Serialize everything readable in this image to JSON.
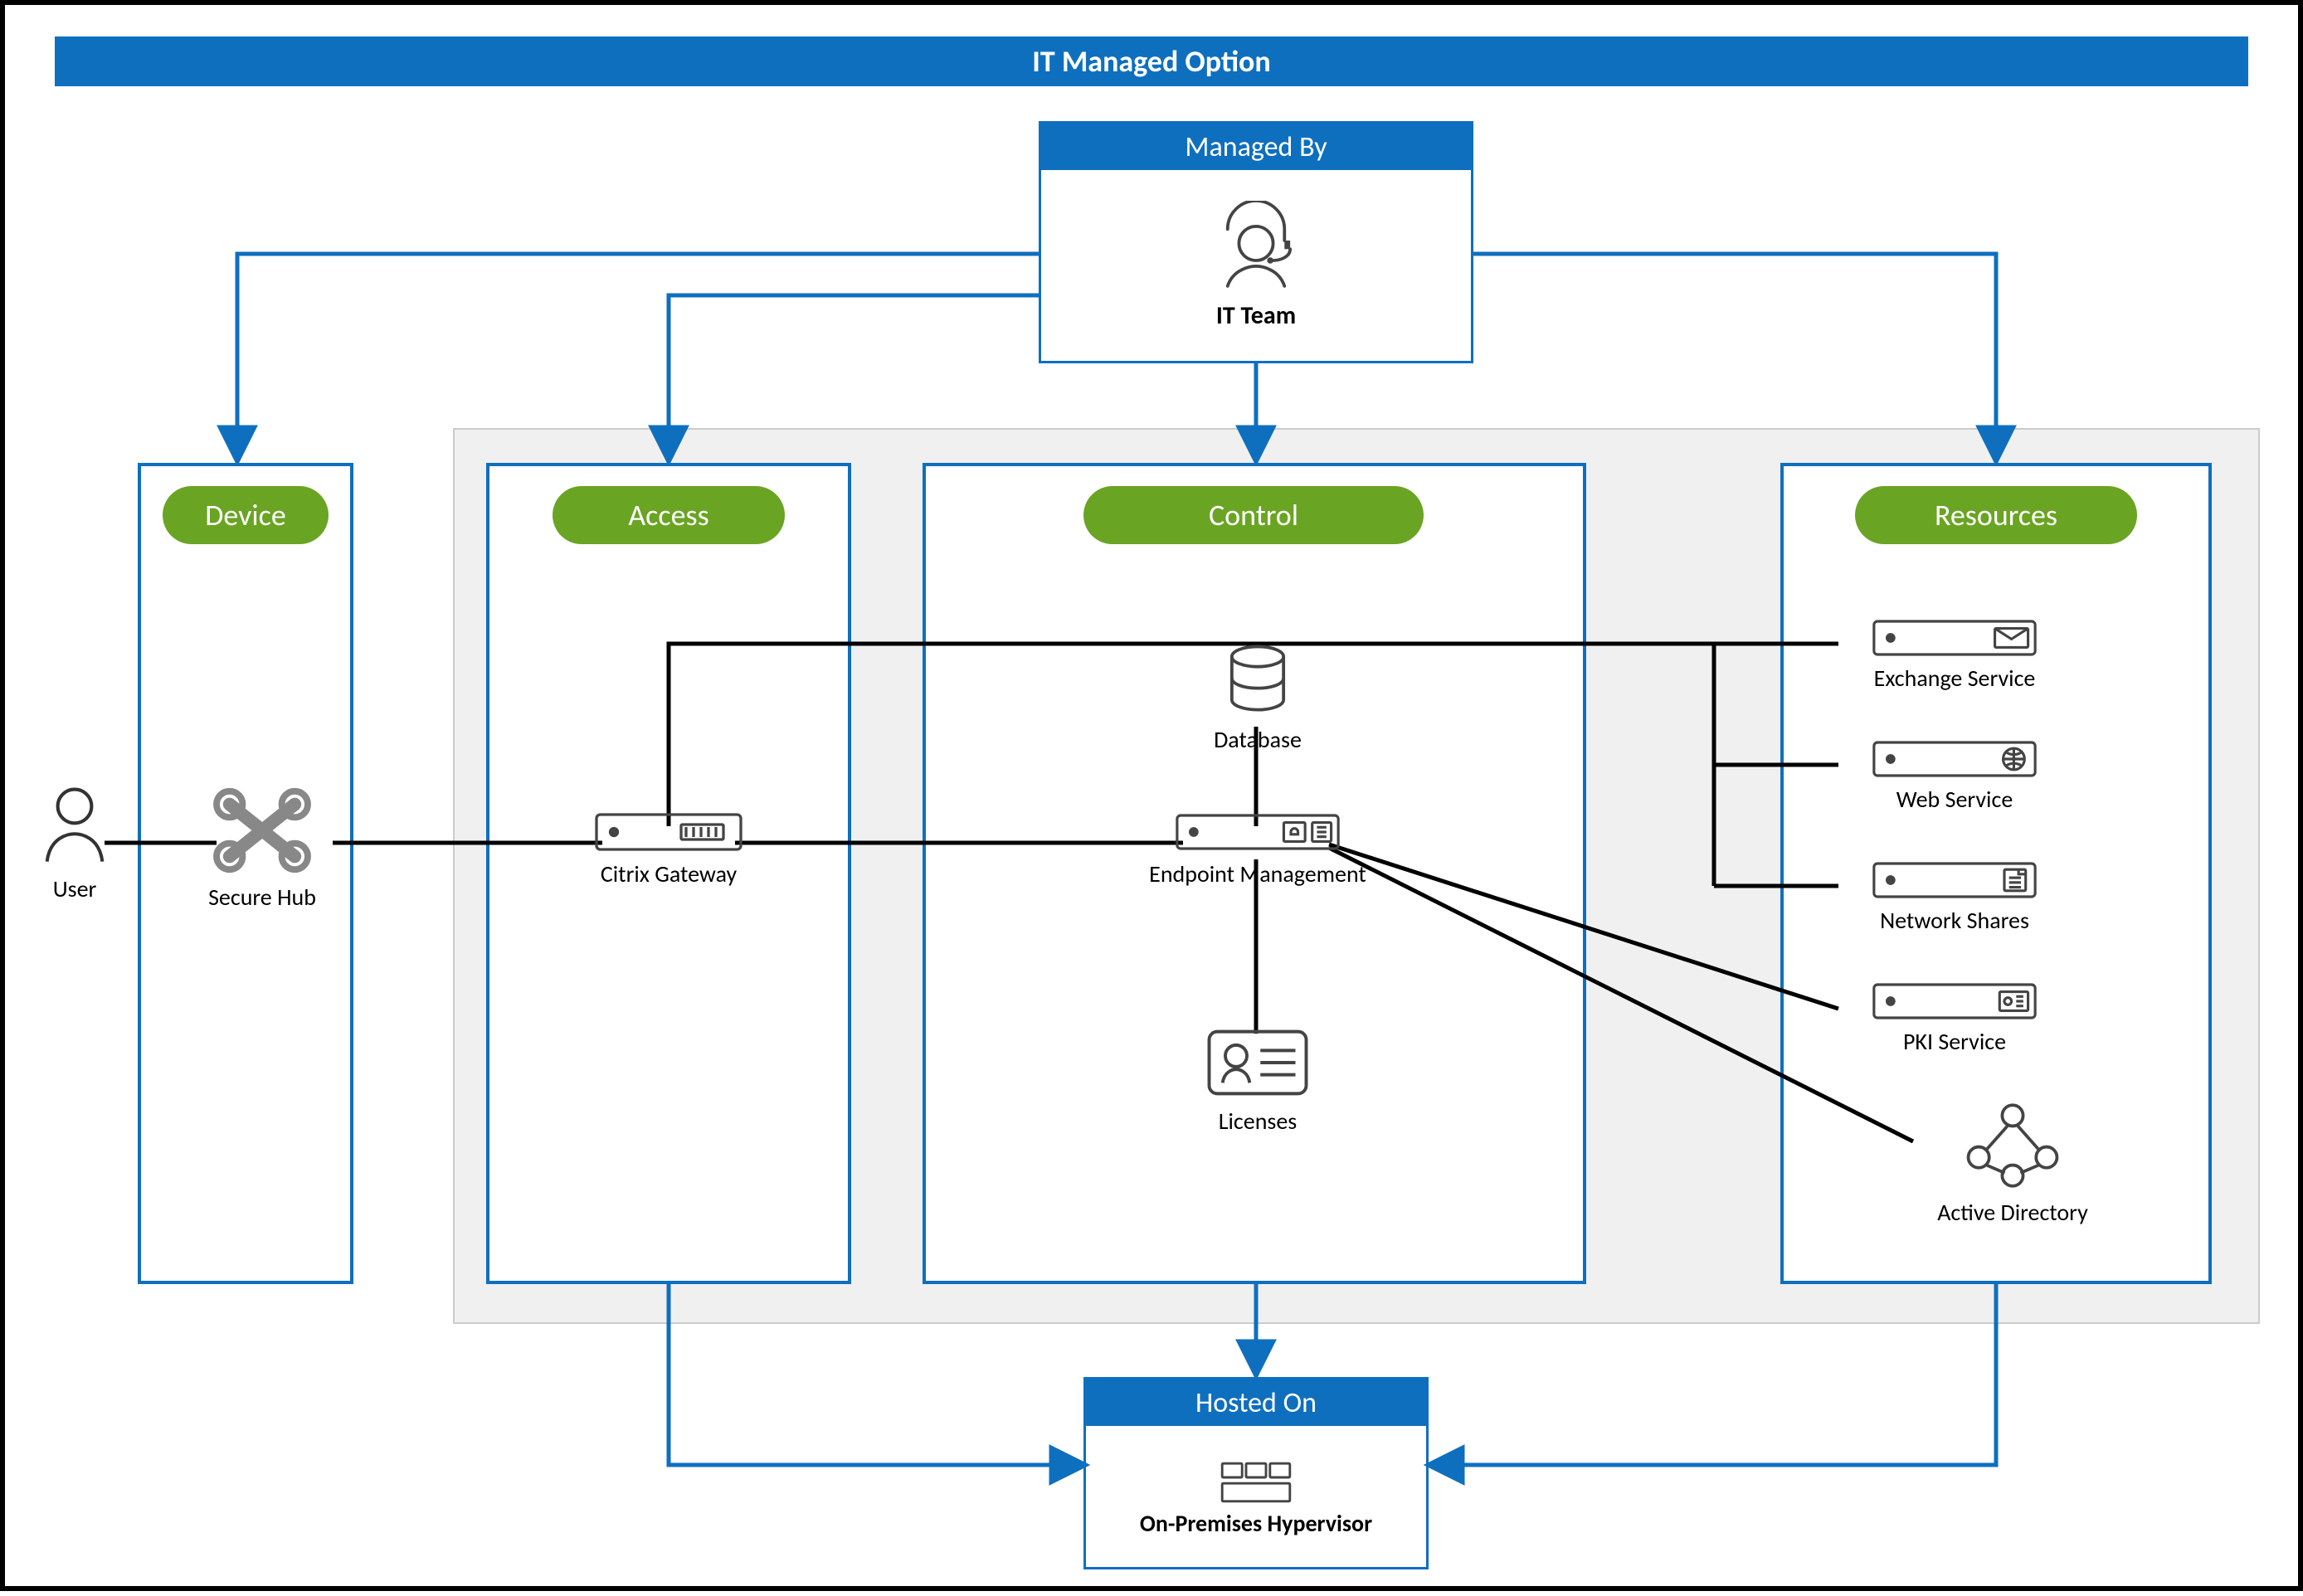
{
  "title": "IT Managed Option",
  "managedBy": {
    "header": "Managed By",
    "label": "IT Team"
  },
  "hostedOn": {
    "header": "Hosted On",
    "label": "On-Premises Hypervisor"
  },
  "zones": {
    "device": "Device",
    "access": "Access",
    "control": "Control",
    "resources": "Resources"
  },
  "nodes": {
    "user": "User",
    "secureHub": "Secure Hub",
    "gateway": "Citrix Gateway",
    "database": "Database",
    "endpoint": "Endpoint Management",
    "licenses": "Licenses",
    "exchange": "Exchange Service",
    "web": "Web Service",
    "shares": "Network Shares",
    "pki": "PKI Service",
    "ad": "Active Directory"
  },
  "colors": {
    "blue": "#0f6fbf",
    "green": "#6aa423",
    "black": "#000000",
    "grey": "#f0f0f0",
    "stroke": "#333333"
  },
  "diagram": {
    "blue_arrows_from_managed_by_to": [
      "device-zone",
      "access-zone",
      "control-zone",
      "resources-zone"
    ],
    "blue_arrows_to_hosted_on_from": [
      "access-zone",
      "control-zone",
      "resources-zone"
    ],
    "black_links": [
      [
        "user",
        "secureHub"
      ],
      [
        "secureHub",
        "gateway"
      ],
      [
        "gateway",
        "endpoint"
      ],
      [
        "database",
        "endpoint"
      ],
      [
        "endpoint",
        "licenses"
      ],
      [
        "gateway",
        "exchange-web-shares-branch"
      ],
      [
        "endpoint",
        "pki"
      ],
      [
        "endpoint",
        "ad"
      ]
    ]
  }
}
